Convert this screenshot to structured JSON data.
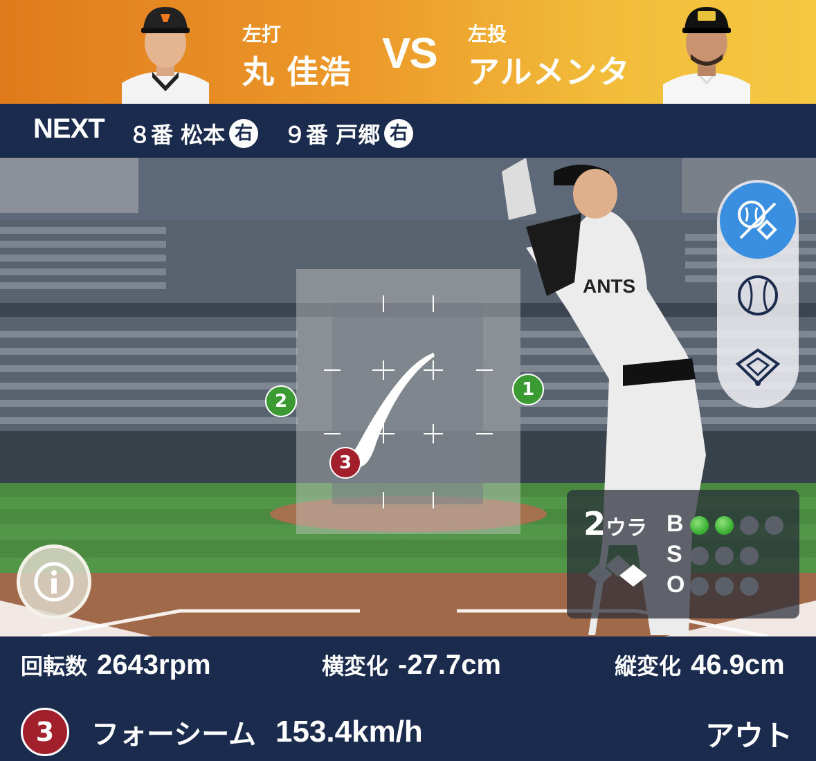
{
  "header": {
    "batter": {
      "hand": "左打",
      "name": "丸 佳浩"
    },
    "vs": "VS",
    "pitcher": {
      "hand": "左投",
      "name": "アルメンタ"
    }
  },
  "next": {
    "label": "NEXT",
    "batters": [
      {
        "order": "８番 松本",
        "hand": "右"
      },
      {
        "order": "９番 戸郷",
        "hand": "右"
      }
    ]
  },
  "zone": {
    "markers": [
      {
        "num": "1",
        "color": "#3b9a32"
      },
      {
        "num": "2",
        "color": "#3b9a32"
      },
      {
        "num": "3",
        "color": "#a2202c"
      }
    ]
  },
  "count": {
    "runner_num": "2",
    "runner_label": "ウラ",
    "labels": {
      "b": "B",
      "s": "S",
      "o": "O"
    },
    "balls": 2,
    "strikes": 0,
    "outs": 0
  },
  "stats": {
    "spin": {
      "label": "回転数",
      "value": "2643rpm"
    },
    "horizontal": {
      "label": "横変化",
      "value": "-27.7cm"
    },
    "vertical": {
      "label": "縦変化",
      "value": "46.9cm"
    }
  },
  "pitch": {
    "num": "3",
    "type": "フォーシーム",
    "speed": "153.4km/h",
    "result": "アウト"
  },
  "icons": {
    "view_modes": [
      "pitch-location-icon",
      "ball-icon",
      "field-icon"
    ],
    "info": "info-icon"
  }
}
